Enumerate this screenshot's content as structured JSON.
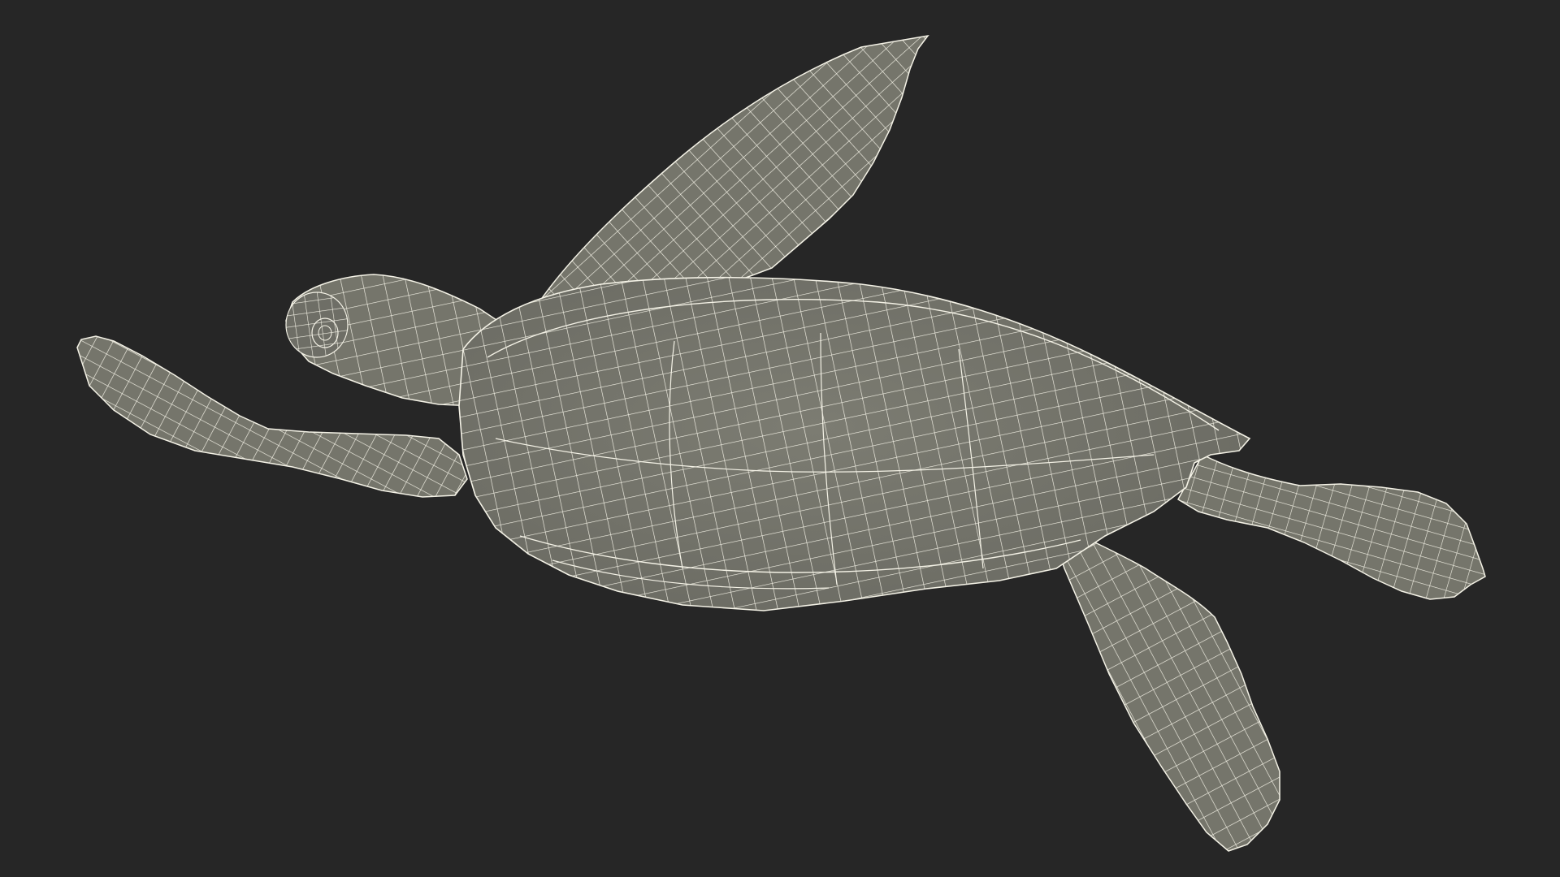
{
  "scene": {
    "subject": "turtle-wireframe-model",
    "colors": {
      "background": "#262626",
      "surface": "#75756b",
      "surface_dark": "#676760",
      "surface_light": "#82827a",
      "wire": "#f4f2e6"
    }
  }
}
